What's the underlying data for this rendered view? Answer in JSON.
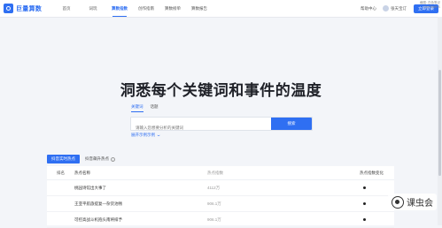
{
  "brand": {
    "logo_text": "巨量算数"
  },
  "nav": {
    "items": [
      "首页",
      "词玩",
      "算数指数",
      "创作指南",
      "算数榜单",
      "算数报告"
    ],
    "active_index": 2
  },
  "topbar": {
    "help": "帮助中心",
    "user": "张天宝订",
    "login": "立即登录",
    "corner_line1": "截图: 白色笔记",
    "corner_line2": "Ctrl+Shift+S"
  },
  "hero": {
    "title": "洞悉每个关键词和事件的温度"
  },
  "search": {
    "tabs": [
      "关键词",
      "话题"
    ],
    "active_tab": 0,
    "placeholder": "请输入您想要分析的关键词",
    "button": "搜索",
    "examples": "展开示例示例"
  },
  "hot": {
    "tabs": [
      "抖音实时热点",
      "抖音飙升热点"
    ],
    "active_tab": 0
  },
  "table": {
    "headers": [
      "排名",
      "热点名称",
      "热点指数",
      "热点指数变化"
    ],
    "rows": [
      {
        "rank": "",
        "name": "桃园诗馆出大事了",
        "index": "4112万"
      },
      {
        "rank": "",
        "name": "王亚平航旅提复—杂货池畅",
        "index": "906.1万"
      },
      {
        "rank": "",
        "name": "可控高战斗机抱头南将排予",
        "index": "906.1万"
      }
    ]
  },
  "watermark": {
    "text": "课虫会"
  },
  "colors": {
    "accent": "#2f6ff2",
    "background": "#f3f5f9"
  }
}
